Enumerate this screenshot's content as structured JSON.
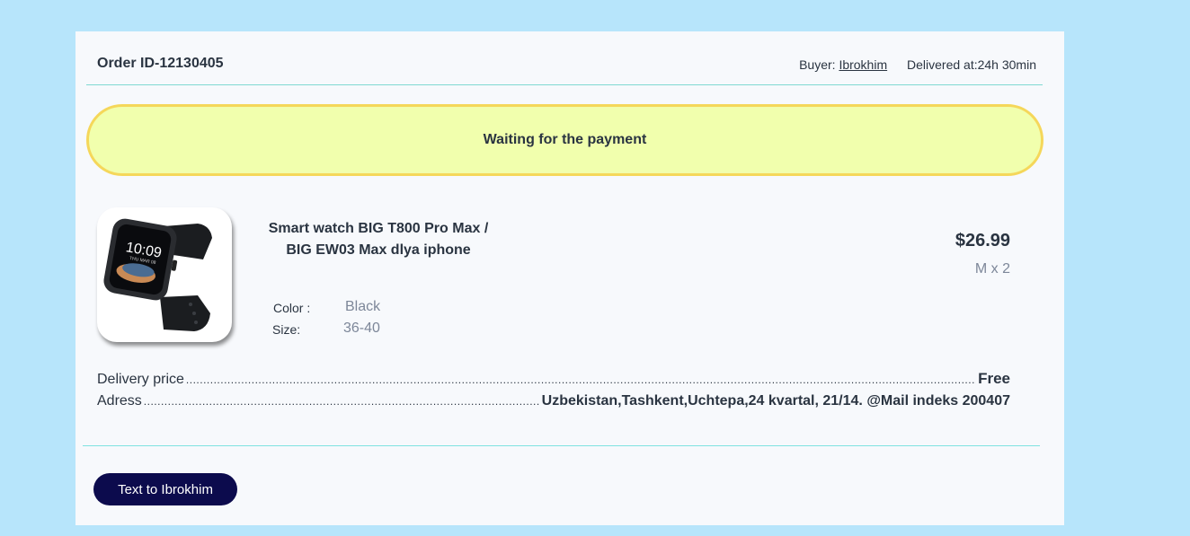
{
  "order": {
    "id_label": "Order ID-12130405",
    "buyer_label": "Buyer:",
    "buyer_name": "Ibrokhim",
    "delivered_label": "Delivered at:24h 30min"
  },
  "status": {
    "text": "Waiting for the payment",
    "background": "#f1ffad",
    "border": "#f5d75a"
  },
  "product": {
    "image_icon": "smartwatch-image",
    "title_line1": "Smart watch BIG T800 Pro Max /",
    "title_line2": "BIG EW03 Max dlya iphone",
    "color_label": "Color :",
    "color_value": "Black",
    "size_label": "Size:",
    "size_value": "36-40",
    "price": "$26.99",
    "quantity": "M x 2"
  },
  "delivery": {
    "label": "Delivery price",
    "value": "Free"
  },
  "address": {
    "label": "Adress",
    "value": "Uzbekistan,Tashkent,Uchtepa,24 kvartal, 21/14. @Mail indeks 200407"
  },
  "actions": {
    "text_button_label": "Text to Ibrokhim",
    "button_color": "#0c0b4d"
  },
  "colors": {
    "page_background": "#b7e5fb",
    "card_background": "#f7f9fc",
    "divider": "#7fd9d2"
  }
}
